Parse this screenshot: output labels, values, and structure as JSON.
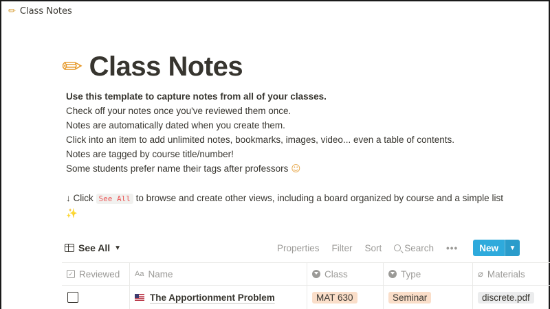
{
  "window": {
    "icon": "pencil-icon",
    "title": "Class Notes"
  },
  "page": {
    "icon": "pencil-icon",
    "title": "Class Notes",
    "description": {
      "line1": "Use this template to capture notes from all of your classes.",
      "line2": "Check off your notes once you've reviewed them once.",
      "line3": "Notes are automatically dated when you create them.",
      "line4": "Click into an item to add unlimited notes, bookmarks, images, video... even a table of contents.",
      "line5": "Notes are tagged by course title/number!",
      "line6": "Some students prefer name their tags after professors",
      "line7_prefix": "↓ Click",
      "line7_code": "See All",
      "line7_suffix": "to browse and create other views, including a board organized by course and a simple list"
    }
  },
  "toolbar": {
    "view_label": "See All",
    "properties": "Properties",
    "filter": "Filter",
    "sort": "Sort",
    "search": "Search",
    "more": "•••",
    "new_label": "New"
  },
  "table": {
    "columns": [
      {
        "label": "Reviewed",
        "icon": "checkbox-icon"
      },
      {
        "label": "Name",
        "icon": "text-icon"
      },
      {
        "label": "Class",
        "icon": "select-icon"
      },
      {
        "label": "Type",
        "icon": "select-icon"
      },
      {
        "label": "Materials",
        "icon": "paperclip-icon"
      }
    ],
    "rows": [
      {
        "reviewed": false,
        "name_icon": "us-flag-icon",
        "name": "The Apportionment Problem",
        "class": "MAT 630",
        "type": "Seminar",
        "materials": "discrete.pdf"
      }
    ]
  },
  "colors": {
    "accent": "#2eaadc",
    "text": "#37352f",
    "muted": "#9b9a97",
    "tag_orange": "#fadec9",
    "code_red": "#eb5757"
  }
}
